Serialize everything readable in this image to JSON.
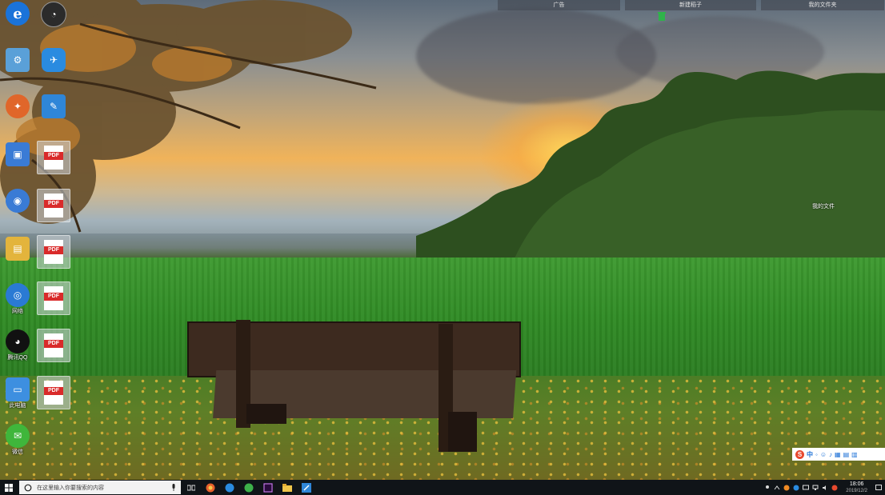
{
  "top_bar": {
    "items": [
      "广告",
      "新建稻子",
      "我的文件夹"
    ]
  },
  "desktop_icons": [
    {
      "name": "ie-icon",
      "label": "",
      "color": "#1a73d9",
      "glyph": "e"
    },
    {
      "name": "app-icon-1",
      "label": "",
      "color": "#2b2b2b",
      "glyph": "◔"
    },
    {
      "name": "app-icon-2",
      "label": "",
      "color": "#5aa0d8",
      "glyph": "⚙"
    },
    {
      "name": "app-icon-3",
      "label": "",
      "color": "#2a8be0",
      "glyph": "✈"
    },
    {
      "name": "app-icon-4",
      "label": "",
      "color": "#e0662a",
      "glyph": "✦"
    },
    {
      "name": "app-icon-5",
      "label": "",
      "color": "#2f86d8",
      "glyph": "✎"
    },
    {
      "name": "app-icon-6",
      "label": "",
      "color": "#3a7bd5",
      "glyph": "▣"
    },
    {
      "name": "app-icon-7",
      "label": "",
      "color": "#3a7bd5",
      "glyph": "◉"
    },
    {
      "name": "folder-icon",
      "label": "",
      "color": "#e3b43c",
      "glyph": "▤"
    },
    {
      "name": "network-icon",
      "label": "网络",
      "color": "#2a7ad4",
      "glyph": "◎"
    },
    {
      "name": "qq-icon",
      "label": "腾讯QQ",
      "color": "#111",
      "glyph": "◕"
    },
    {
      "name": "computer-icon",
      "label": "此电脑",
      "color": "#3d8fe0",
      "glyph": "▭"
    },
    {
      "name": "wechat-icon",
      "label": "微信",
      "color": "#3fb63b",
      "glyph": "✉"
    }
  ],
  "pdf_icon_text": "PDF",
  "desktop_label_right": "我的文件",
  "ime": {
    "logo": "S",
    "lang": "中"
  },
  "taskbar": {
    "search_placeholder": "在这里输入你要搜索的内容",
    "clock_time": "18:06",
    "clock_date": "2019/12/2"
  },
  "colors": {
    "taskbar": "#101418",
    "pdf_red": "#d92a2a"
  }
}
